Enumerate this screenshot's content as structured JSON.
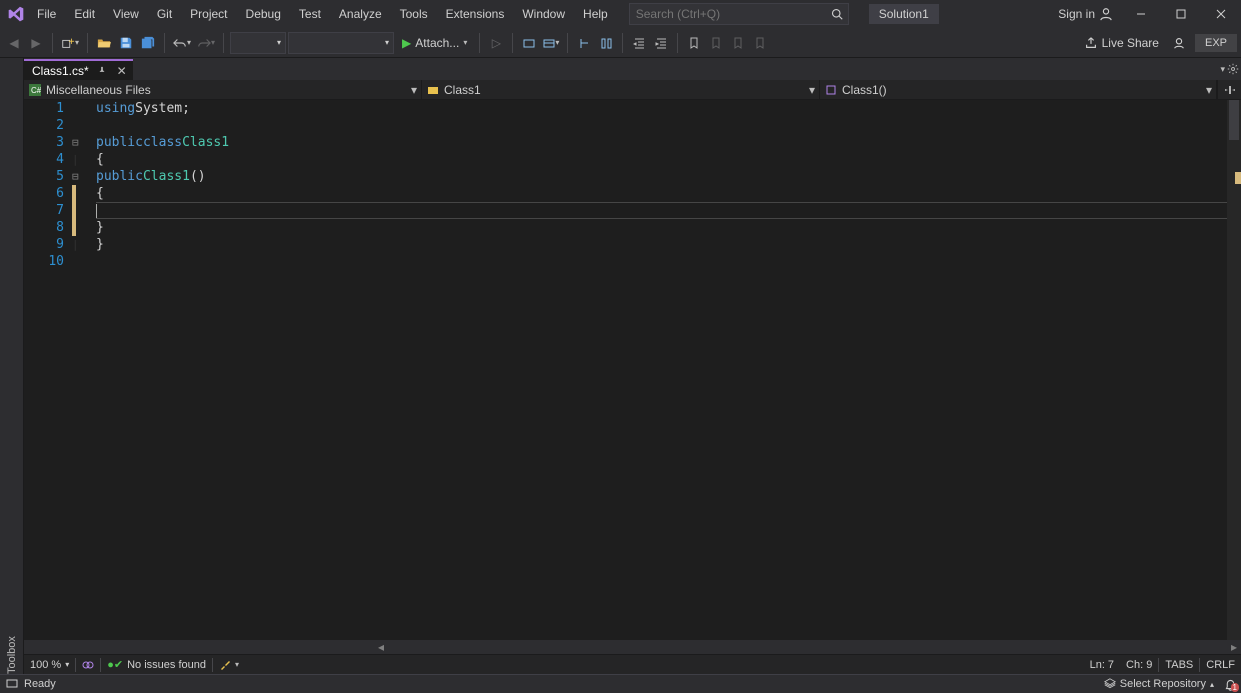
{
  "menu": {
    "items": [
      "File",
      "Edit",
      "View",
      "Git",
      "Project",
      "Debug",
      "Test",
      "Analyze",
      "Tools",
      "Extensions",
      "Window",
      "Help"
    ]
  },
  "search": {
    "placeholder": "Search (Ctrl+Q)"
  },
  "solution_name": "Solution1",
  "signin": "Sign in",
  "toolbar": {
    "attach": "Attach...",
    "liveshare": "Live Share",
    "exp": "EXP"
  },
  "toolbox": "Toolbox",
  "tab": {
    "title": "Class1.cs*"
  },
  "crumbs": {
    "a": "Miscellaneous Files",
    "b": "Class1",
    "c": "Class1()"
  },
  "code": {
    "lines": [
      {
        "n": 1,
        "fold": "",
        "html": "    <span class='kw'>using</span> <span class='pln'>System</span><span class='pnc'>;</span>"
      },
      {
        "n": 2,
        "fold": "",
        "html": ""
      },
      {
        "n": 3,
        "fold": "⊟",
        "html": "<span class='kw'>public</span> <span class='kw'>class</span> <span class='typ'>Class1</span>"
      },
      {
        "n": 4,
        "fold": "|",
        "html": "<span class='pnc'>{</span>"
      },
      {
        "n": 5,
        "fold": "⊟",
        "html": "    <span class='kw'>public</span> <span class='typ'>Class1</span><span class='pnc'>()</span>"
      },
      {
        "n": 6,
        "fold": "|",
        "html": "    <span class='pnc'>{</span>"
      },
      {
        "n": 7,
        "fold": "|",
        "html": "        <span class='caret'></span>",
        "current": true
      },
      {
        "n": 8,
        "fold": "|",
        "html": "    <span class='pnc'>}</span>"
      },
      {
        "n": 9,
        "fold": "|",
        "html": "<span class='pnc'>}</span>"
      },
      {
        "n": 10,
        "fold": "",
        "html": ""
      }
    ]
  },
  "editor_status": {
    "zoom": "100 %",
    "issues": "No issues found",
    "ln": "Ln: 7",
    "ch": "Ch: 9",
    "indent": "TABS",
    "eol": "CRLF"
  },
  "statusbar": {
    "ready": "Ready",
    "repo": "Select Repository",
    "notifications": "1"
  }
}
